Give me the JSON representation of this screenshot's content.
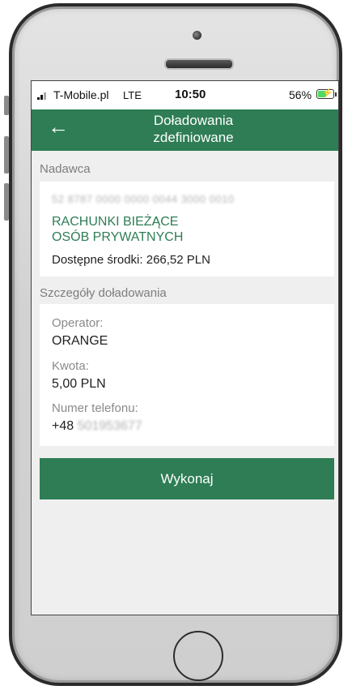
{
  "status_bar": {
    "carrier": "T-Mobile.pl",
    "network": "LTE",
    "time": "10:50",
    "battery": "56%",
    "battery_level": 0.56,
    "battery_color": "#4cd964"
  },
  "header": {
    "back_icon": "arrow-left-icon",
    "title_line1": "Doładowania",
    "title_line2": "zdefiniowane",
    "color": "#2e7d55"
  },
  "sender": {
    "section_label": "Nadawca",
    "account_number": "52 8787 0000 0000 0044 3000 0010",
    "account_name_line1": "RACHUNKI BIEŻĄCE",
    "account_name_line2": "OSÓB PRYWATNYCH",
    "available_funds": "Dostępne środki: 266,52 PLN"
  },
  "details": {
    "section_label": "Szczegóły doładowania",
    "operator_label": "Operator:",
    "operator_value": "ORANGE",
    "amount_label": "Kwota:",
    "amount_value": "5,00 PLN",
    "phone_label": "Numer telefonu:",
    "phone_prefix": "+48",
    "phone_number": "501953677"
  },
  "actions": {
    "execute_label": "Wykonaj"
  }
}
